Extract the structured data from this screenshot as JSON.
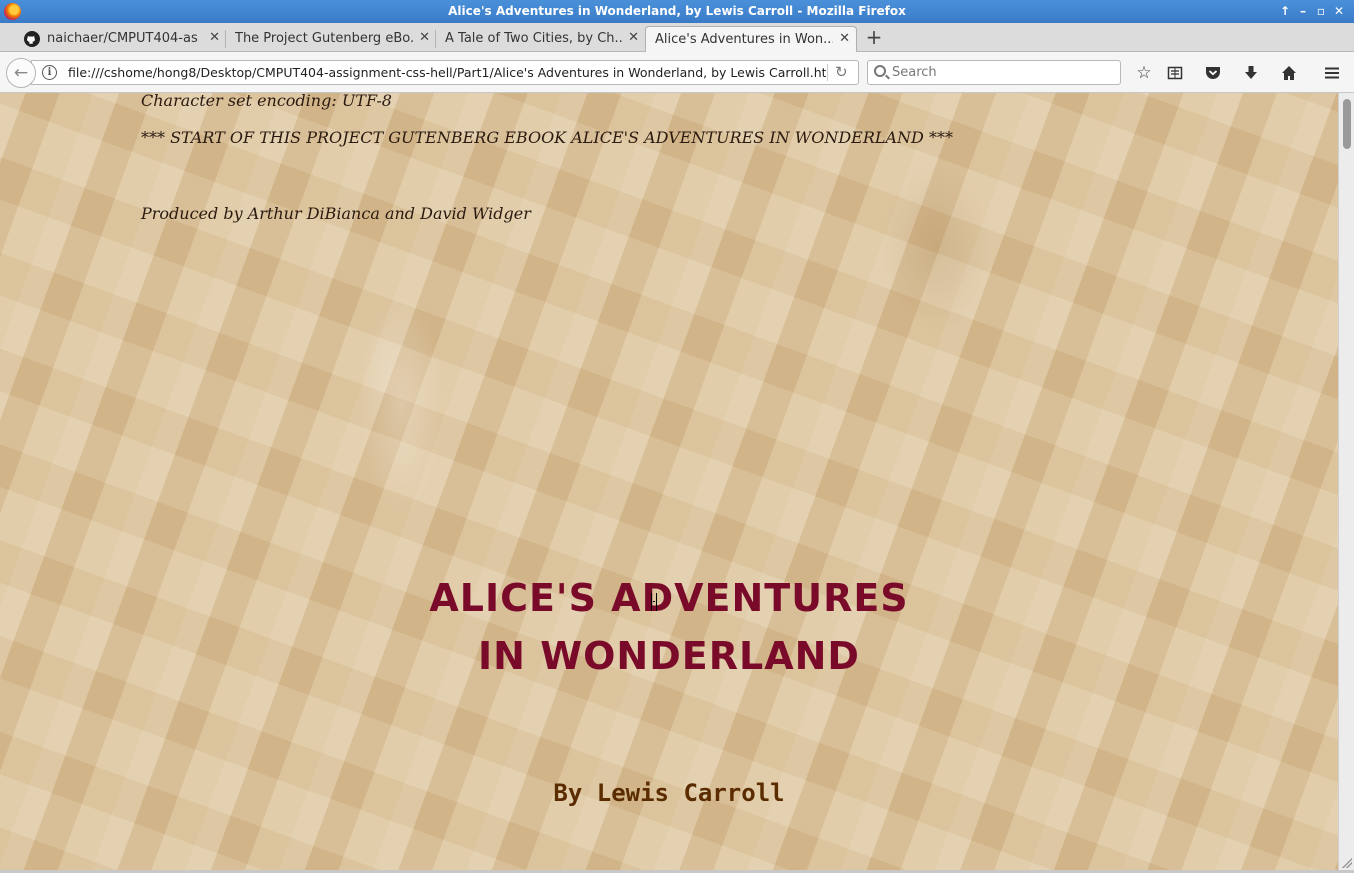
{
  "window": {
    "title": "Alice's Adventures in Wonderland, by Lewis Carroll - Mozilla Firefox",
    "controls": [
      "up-arrow-icon",
      "minimize-icon",
      "maximize-icon",
      "close-icon"
    ]
  },
  "tabs": [
    {
      "label": "naichaer/CMPUT404-as...",
      "icon": "github-icon",
      "active": false
    },
    {
      "label": "The Project Gutenberg eBo...",
      "icon": null,
      "active": false
    },
    {
      "label": "A Tale of Two Cities, by Ch...",
      "icon": null,
      "active": false
    },
    {
      "label": "Alice's Adventures in Won...",
      "icon": null,
      "active": true
    }
  ],
  "navbar": {
    "url": "file:///cshome/hong8/Desktop/CMPUT404-assignment-css-hell/Part1/Alice's Adventures in Wonderland, by Lewis Carroll.htm",
    "search_placeholder": "Search",
    "toolbar_icons": [
      "bookmark-star-icon",
      "reading-list-icon",
      "pocket-icon",
      "download-icon",
      "home-icon",
      "menu-icon"
    ]
  },
  "page": {
    "encoding_line": "Character set encoding: UTF-8",
    "start_line": "*** START OF THIS PROJECT GUTENBERG EBOOK ALICE'S ADVENTURES IN WONDERLAND ***",
    "produced_line": "Produced by Arthur DiBianca and David Widger",
    "title_line1": "ALICE'S ADVENTURES",
    "title_line2": "IN WONDERLAND",
    "author_line": "By Lewis Carroll",
    "colors": {
      "title": "#7a0a2a",
      "author": "#5a2c00",
      "background": "#d9bf96"
    }
  }
}
